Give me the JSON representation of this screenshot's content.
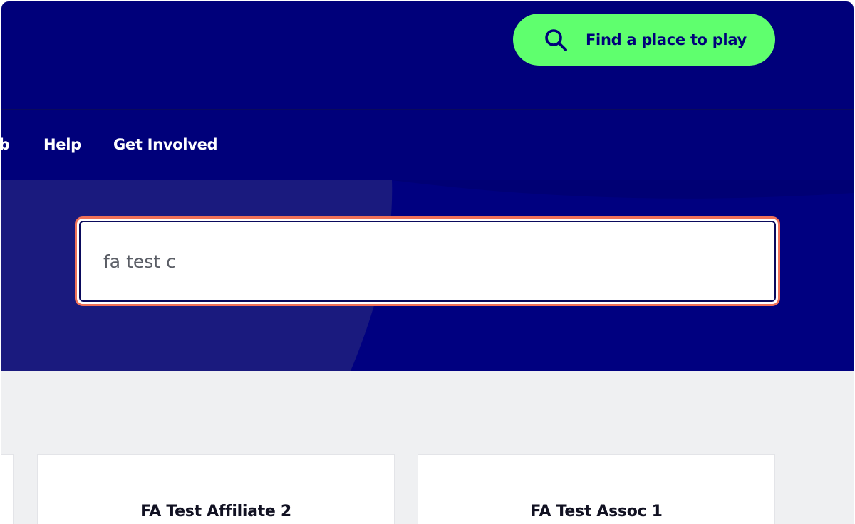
{
  "header": {
    "find_button": {
      "label": "Find a place to play",
      "icon": "search-icon"
    }
  },
  "nav": {
    "items": [
      {
        "label": "ub"
      },
      {
        "label": "Help"
      },
      {
        "label": "Get Involved"
      }
    ]
  },
  "search": {
    "value": "fa test c",
    "focused": true
  },
  "results": {
    "cards": [
      {
        "title": ""
      },
      {
        "title": "FA Test Affiliate 2"
      },
      {
        "title": "FA Test Assoc 1"
      }
    ]
  },
  "colors": {
    "navy": "#00007a",
    "accent_green": "#5fff6e",
    "focus_ring": "#f07158",
    "page_bg": "#eff0f2"
  }
}
